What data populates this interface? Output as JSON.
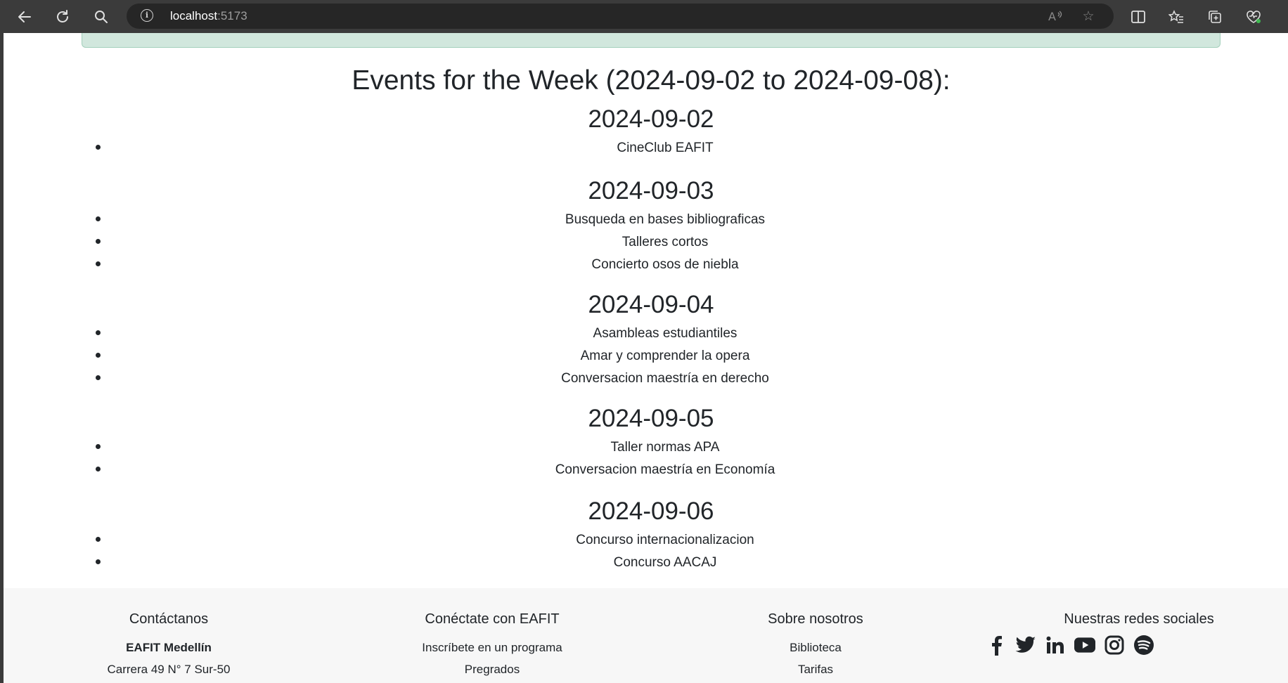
{
  "browser": {
    "url_host": "localhost",
    "url_port": ":5173"
  },
  "page": {
    "week_title": "Events for the Week (2024-09-02 to 2024-09-08):",
    "days": [
      {
        "date": "2024-09-02",
        "events": [
          "CineClub EAFIT"
        ]
      },
      {
        "date": "2024-09-03",
        "events": [
          "Busqueda en bases bibliograficas",
          "Talleres cortos",
          "Concierto osos de niebla"
        ]
      },
      {
        "date": "2024-09-04",
        "events": [
          "Asambleas estudiantiles",
          "Amar y comprender la opera",
          "Conversacion maestría en derecho"
        ]
      },
      {
        "date": "2024-09-05",
        "events": [
          "Taller normas APA",
          "Conversacion maestría en Economía"
        ]
      },
      {
        "date": "2024-09-06",
        "events": [
          "Concurso internacionalizacion",
          "Concurso AACAJ"
        ]
      }
    ]
  },
  "footer": {
    "contact": {
      "heading": "Contáctanos",
      "line1": "EAFIT Medellín",
      "line2": "Carrera 49 N° 7 Sur-50"
    },
    "connect": {
      "heading": "Conéctate con EAFIT",
      "line1": "Inscríbete en un programa",
      "line2": "Pregrados"
    },
    "about": {
      "heading": "Sobre nosotros",
      "line1": "Biblioteca",
      "line2": "Tarifas"
    },
    "social": {
      "heading": "Nuestras redes sociales",
      "icons": [
        "facebook-icon",
        "twitter-icon",
        "linkedin-icon",
        "youtube-icon",
        "instagram-icon",
        "spotify-icon"
      ]
    }
  }
}
